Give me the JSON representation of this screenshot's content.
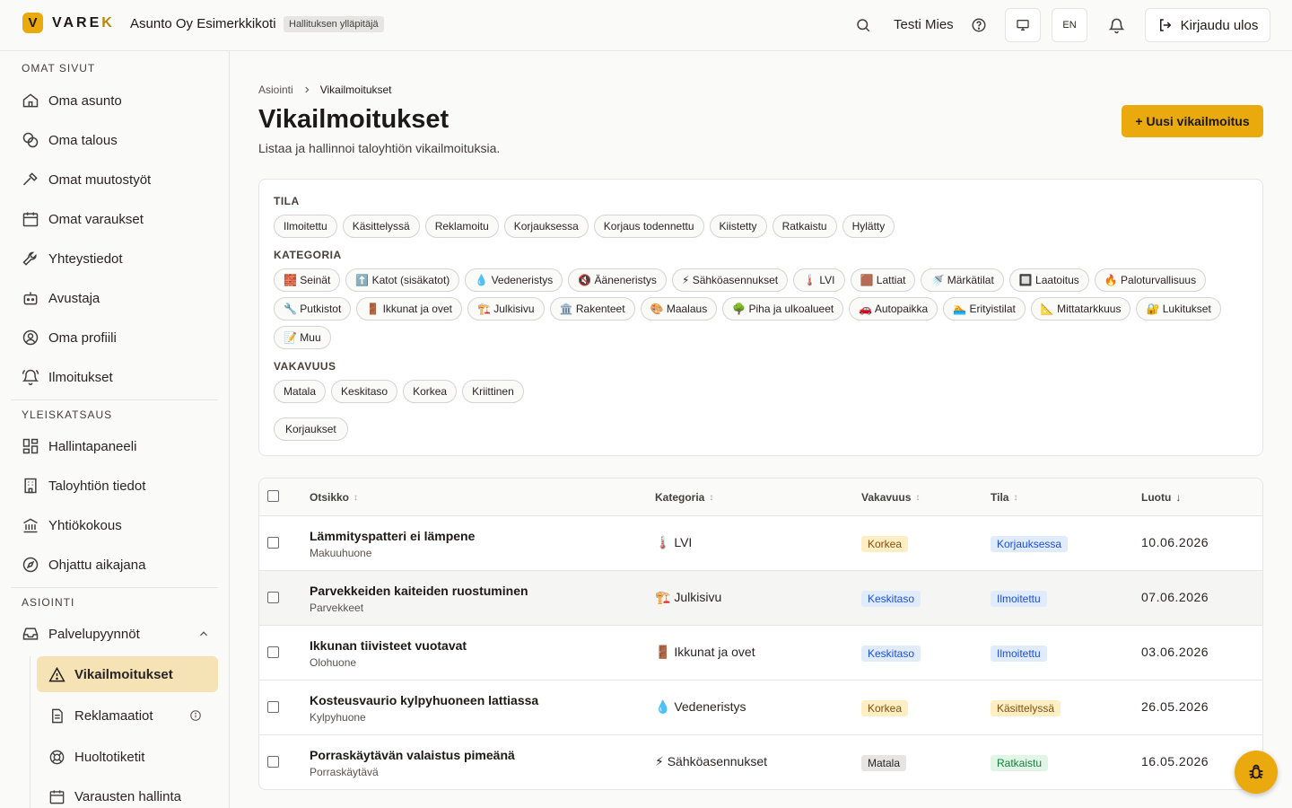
{
  "header": {
    "logo_text": "VAREK",
    "org_name": "Asunto Oy Esimerkkikoti",
    "org_role_badge": "Hallituksen ylläpitäjä",
    "user_name": "Testi Mies",
    "language": "EN",
    "logout_label": "Kirjaudu ulos"
  },
  "sidebar": {
    "section_own": "OMAT SIVUT",
    "own_items": [
      {
        "label": "Oma asunto",
        "icon": "home-icon"
      },
      {
        "label": "Oma talous",
        "icon": "coins-icon"
      },
      {
        "label": "Omat muutostyöt",
        "icon": "hammer-icon"
      },
      {
        "label": "Omat varaukset",
        "icon": "calendar-icon"
      },
      {
        "label": "Yhteystiedot",
        "icon": "wrench-icon"
      },
      {
        "label": "Avustaja",
        "icon": "bot-icon"
      },
      {
        "label": "Oma profiili",
        "icon": "user-circle-icon"
      },
      {
        "label": "Ilmoitukset",
        "icon": "bell-ring-icon"
      }
    ],
    "section_overview": "YLEISKATSAUS",
    "overview_items": [
      {
        "label": "Hallintapaneeli",
        "icon": "dashboard-icon"
      },
      {
        "label": "Taloyhtiön tiedot",
        "icon": "building-icon"
      },
      {
        "label": "Yhtiökokous",
        "icon": "landmark-icon"
      },
      {
        "label": "Ohjattu aikajana",
        "icon": "compass-icon"
      }
    ],
    "section_services": "ASIOINTI",
    "services_group": "Palvelupyynnöt",
    "services_sub": [
      {
        "label": "Vikailmoitukset",
        "icon": "warning-icon"
      },
      {
        "label": "Reklamaatiot",
        "icon": "document-icon"
      },
      {
        "label": "Huoltotiketit",
        "icon": "lifebuoy-icon"
      },
      {
        "label": "Varausten hallinta",
        "icon": "calendar-icon"
      }
    ]
  },
  "main": {
    "breadcrumb_root": "Asiointi",
    "breadcrumb_current": "Vikailmoitukset",
    "title": "Vikailmoitukset",
    "subtitle": "Listaa ja hallinnoi taloyhtiön vikailmoituksia.",
    "new_button": "+ Uusi vikailmoitus"
  },
  "filters": {
    "status_label": "TILA",
    "status": [
      "Ilmoitettu",
      "Käsittelyssä",
      "Reklamoitu",
      "Korjauksessa",
      "Korjaus todennettu",
      "Kiistetty",
      "Ratkaistu",
      "Hylätty"
    ],
    "category_label": "KATEGORIA",
    "categories": [
      "🧱 Seinät",
      "⬆️ Katot (sisäkatot)",
      "💧 Vedeneristys",
      "🔇 Ääneneristys",
      "⚡ Sähköasennukset",
      "🌡️ LVI",
      "🟫 Lattiat",
      "🚿 Märkätilat",
      "🔲 Laatoitus",
      "🔥 Paloturvallisuus",
      "🔧 Putkistot",
      "🚪 Ikkunat ja ovet",
      "🏗️ Julkisivu",
      "🏛️ Rakenteet",
      "🎨 Maalaus",
      "🌳 Piha ja ulkoalueet",
      "🚗 Autopaikka",
      "🏊 Erityistilat",
      "📐 Mittatarkkuus",
      "🔐 Lukitukset",
      "📝 Muu"
    ],
    "severity_label": "VAKAVUUS",
    "severity": [
      "Matala",
      "Keskitaso",
      "Korkea",
      "Kriittinen"
    ],
    "extra": "Korjaukset"
  },
  "table": {
    "columns": [
      "Otsikko",
      "Kategoria",
      "Vakavuus",
      "Tila",
      "Luotu"
    ],
    "rows": [
      {
        "title": "Lämmityspatteri ei lämpene",
        "location": "Makuuhuone",
        "category": "🌡️ LVI",
        "severity": "Korkea",
        "status": "Korjauksessa",
        "created": "10.06.2026"
      },
      {
        "title": "Parvekkeiden kaiteiden ruostuminen",
        "location": "Parvekkeet",
        "category": "🏗️ Julkisivu",
        "severity": "Keskitaso",
        "status": "Ilmoitettu",
        "created": "07.06.2026"
      },
      {
        "title": "Ikkunan tiivisteet vuotavat",
        "location": "Olohuone",
        "category": "🚪 Ikkunat ja ovet",
        "severity": "Keskitaso",
        "status": "Ilmoitettu",
        "created": "03.06.2026"
      },
      {
        "title": "Kosteusvaurio kylpyhuoneen lattiassa",
        "location": "Kylpyhuone",
        "category": "💧 Vedeneristys",
        "severity": "Korkea",
        "status": "Käsittelyssä",
        "created": "26.05.2026"
      },
      {
        "title": "Porraskäytävän valaistus pimeänä",
        "location": "Porraskäytävä",
        "category": "⚡ Sähköasennukset",
        "severity": "Matala",
        "status": "Ratkaistu",
        "created": "16.05.2026"
      }
    ]
  },
  "colors": {
    "accent": "#eaa90c",
    "severity_high_bg": "#fdefc3",
    "severity_mid_bg": "#e0ecfb",
    "severity_low_bg": "#e7e5e4",
    "status_blue_bg": "#e0ecfb",
    "status_yellow_bg": "#fdefc3",
    "status_green_bg": "#e1f5e6"
  }
}
